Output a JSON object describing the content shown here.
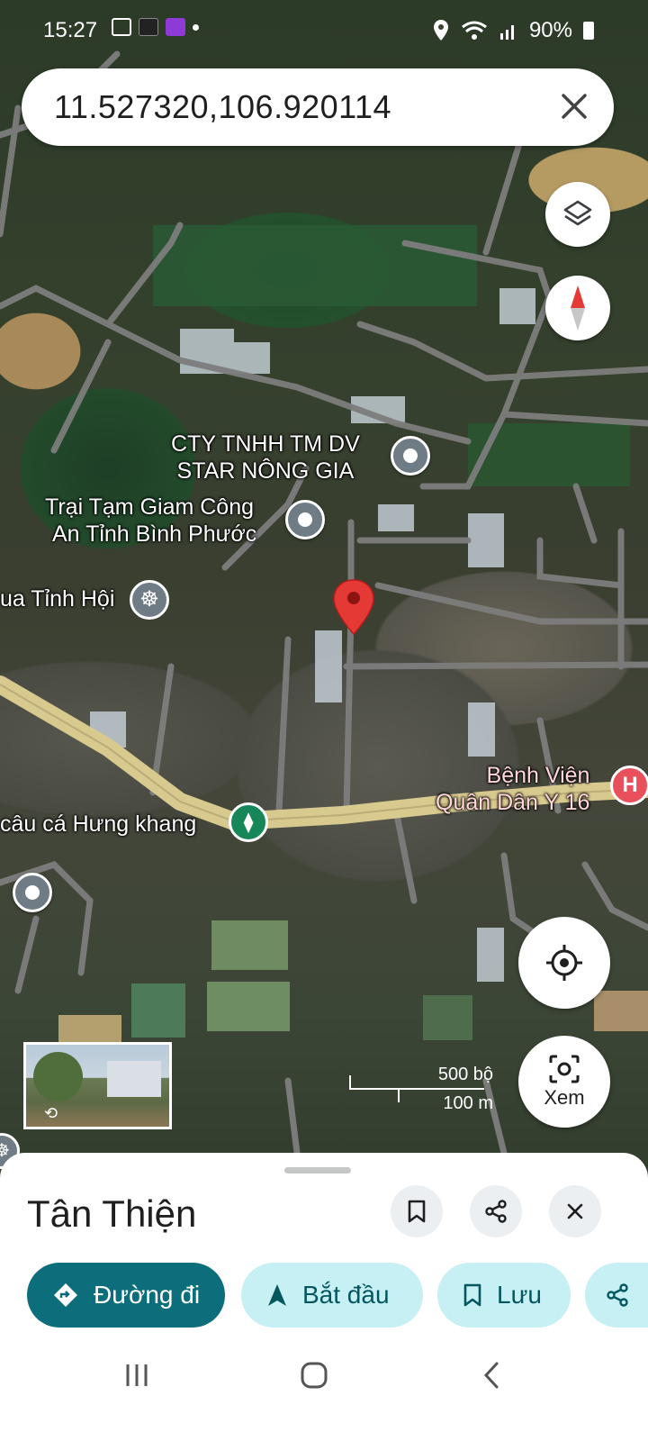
{
  "status_bar": {
    "time": "15:27",
    "battery": "90%",
    "icons": [
      "gallery-icon",
      "app-icon",
      "link-icon",
      "dot-icon",
      "location-icon",
      "wifi-icon",
      "signal-icon",
      "battery-icon"
    ]
  },
  "search": {
    "value": "11.527320,106.920114"
  },
  "map": {
    "labels": {
      "company": [
        "CTY TNHH TM DV",
        "STAR NÔNG GIA"
      ],
      "detention": [
        "Trại Tạm Giam Công",
        "An Tỉnh Bình Phước"
      ],
      "temple": "ua Tỉnh Hội",
      "fishing": "câu cá Hưng khang",
      "hospital": [
        "Bệnh Viện",
        "Quân Dân Y 16"
      ]
    },
    "scale": {
      "imperial": "500 bộ",
      "metric": "100 m"
    },
    "view_button_label": "Xem"
  },
  "sheet": {
    "title": "Tân Thiện",
    "actions": {
      "directions": "Đường đi",
      "start": "Bắt đầu",
      "save": "Lưu"
    }
  },
  "colors": {
    "primary": "#0b6e7a",
    "chip_light": "#c6f0f4",
    "pin_red": "#e53935",
    "road_main": "#d8c98e"
  }
}
